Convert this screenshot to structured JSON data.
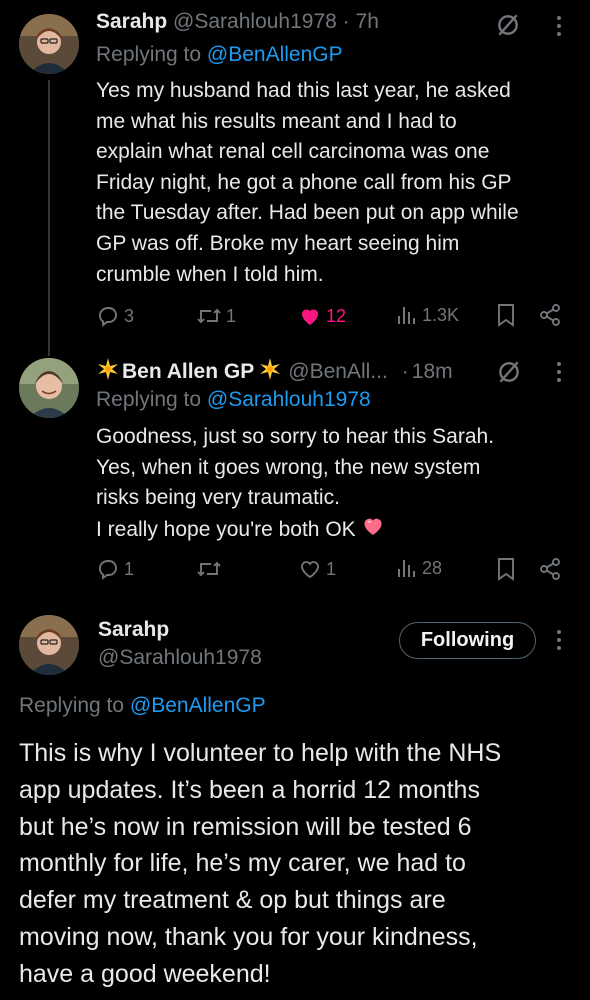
{
  "reply1": {
    "display_name": "Sarahp",
    "handle": "@Sarahlouh1978",
    "separator": "·",
    "time": "7h",
    "replying_prefix": "Replying to",
    "replying_to": "@BenAllenGP",
    "lines": [
      "Yes my husband had this last year, he asked",
      "me what his results meant and I had to",
      "explain what renal cell carcinoma was one",
      "Friday night, he got a phone call from his GP",
      "the Tuesday after. Had been put on app while",
      "GP was off. Broke my heart seeing him",
      "crumble when I told him."
    ],
    "actions": {
      "replies": "3",
      "reposts": "1",
      "likes": "12",
      "views": "1.3K"
    }
  },
  "reply2": {
    "display_name": "Ben Allen GP",
    "handle": "@BenAll...",
    "separator": "·",
    "time": "18m",
    "replying_prefix": "Replying to",
    "replying_to": "@Sarahlouh1978",
    "lines": [
      "Goodness, just so sorry to hear this Sarah.",
      "Yes, when it goes wrong, the new system",
      "risks being very traumatic.",
      "I really hope you're both OK"
    ],
    "actions": {
      "replies": "1",
      "reposts": "",
      "likes": "1",
      "views": "28"
    }
  },
  "focus": {
    "display_name": "Sarahp",
    "handle": "@Sarahlouh1978",
    "follow_label": "Following",
    "replying_prefix": "Replying to",
    "replying_to": "@BenAllenGP",
    "lines": [
      "This is why I volunteer to help with the NHS",
      "app updates. It’s been a horrid 12 months",
      "but he’s now in remission will be tested 6",
      "monthly for life, he’s my carer, we had to",
      "defer my treatment & op but things are",
      "moving now, thank you for your kindness,",
      "have a good weekend!"
    ]
  },
  "colors": {
    "accent": "#1d9bf0",
    "like": "#f91880",
    "muted": "#71767b",
    "text": "#e7e9ea",
    "background": "#000000"
  },
  "icons": [
    "grok-icon",
    "more-icon",
    "reply-icon",
    "repost-icon",
    "like-icon",
    "views-icon",
    "bookmark-icon",
    "share-icon",
    "sparkle-emoji",
    "heart-emoji"
  ]
}
